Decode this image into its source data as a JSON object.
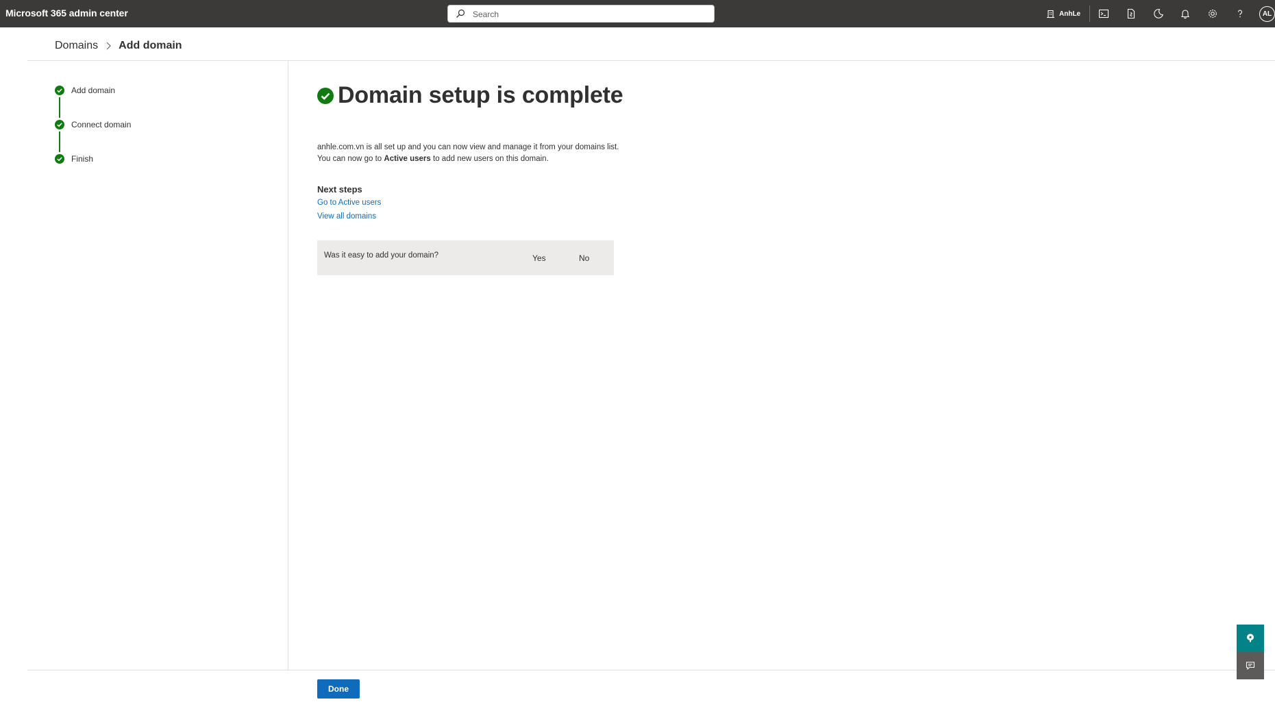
{
  "app": {
    "title": "Microsoft 365 admin center",
    "search_placeholder": "Search",
    "org_name": "AnhLe",
    "avatar_initials": "AL",
    "icons": [
      "org-icon",
      "terminal-icon",
      "document-icon",
      "dark-mode-icon",
      "bell-icon",
      "gear-icon",
      "help-icon"
    ]
  },
  "breadcrumb": {
    "parent": "Domains",
    "current": "Add domain"
  },
  "steps": [
    {
      "label": "Add domain",
      "status": "complete"
    },
    {
      "label": "Connect domain",
      "status": "complete"
    },
    {
      "label": "Finish",
      "status": "complete"
    }
  ],
  "main": {
    "title": "Domain setup is complete",
    "desc_line1": "anhle.com.vn is all set up and you can now view and manage it from your domains list.",
    "desc_line2_prefix": "You can now go to ",
    "desc_line2_bold": "Active users",
    "desc_line2_suffix": " to add new users on this domain.",
    "next_steps_title": "Next steps",
    "links": [
      "Go to Active users",
      "View all domains"
    ]
  },
  "feedback": {
    "question": "Was it easy to add your domain?",
    "yes": "Yes",
    "no": "No"
  },
  "footer": {
    "done_label": "Done"
  },
  "colors": {
    "topbar": "#3b3a39",
    "success": "#107c10",
    "link": "#0f6cbd",
    "primary": "#0f6cbd",
    "help_button": "#038387"
  }
}
